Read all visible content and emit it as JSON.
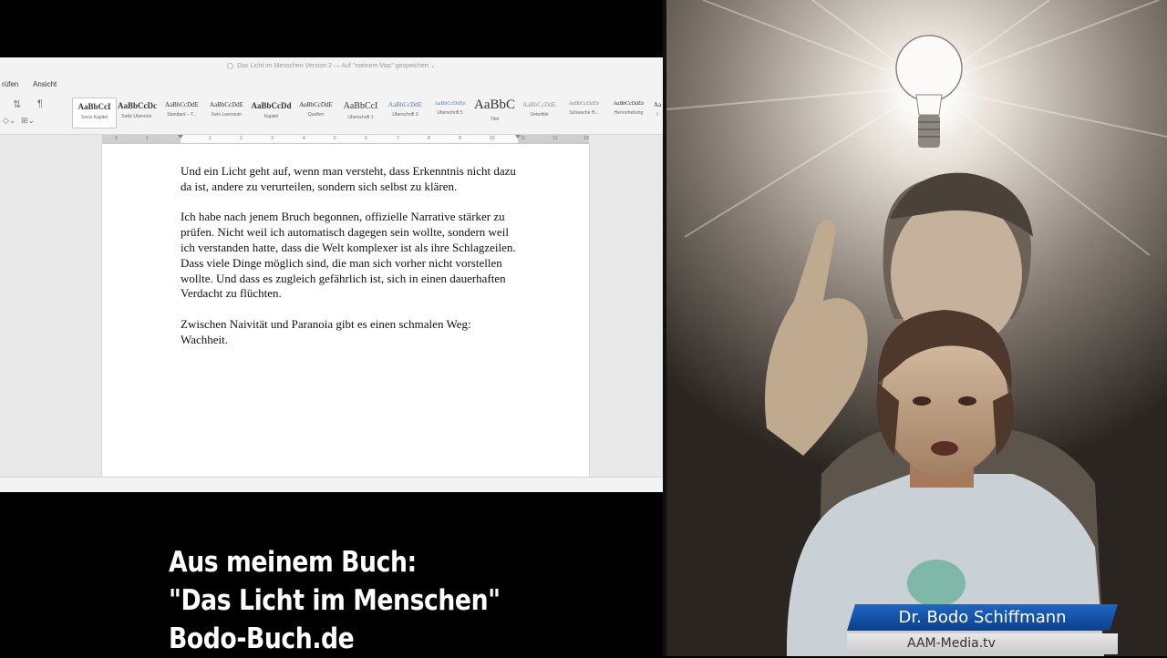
{
  "word": {
    "window_title": "Das Licht im Menschen Version 2 — Auf \"meinem Mac\" gespeichert ⌄",
    "menu": [
      "rüfen",
      "Ansicht"
    ],
    "styles": [
      {
        "sample": "AaBbCcI",
        "name": "Socio Kapitel"
      },
      {
        "sample": "AaBbCcDc",
        "name": "Sodo Überschr."
      },
      {
        "sample": "AaBbCcDdE",
        "name": "Standard – T..."
      },
      {
        "sample": "AaBbCcDdE",
        "name": "Kein Leerraum"
      },
      {
        "sample": "AaBbCcDd",
        "name": "Kapitel"
      },
      {
        "sample": "AaBbCcDdE",
        "name": "Quellen"
      },
      {
        "sample": "AaBbCcI",
        "name": "Überschrift 1"
      },
      {
        "sample": "AaBbCcDdE",
        "name": "Überschrift 3"
      },
      {
        "sample": "AaBbCcDdEe",
        "name": "Überschrift 5"
      },
      {
        "sample": "AaBbC",
        "name": "Titel"
      },
      {
        "sample": "AaBbCcDdE",
        "name": "Untertitle"
      },
      {
        "sample": "AaBbCcDdEe",
        "name": "Schwache H..."
      },
      {
        "sample": "AaBbCcDdEe",
        "name": "Hervorhebung"
      },
      {
        "sample": "Aa",
        "name": "I"
      }
    ],
    "ruler_numbers": [
      "2",
      "1",
      "",
      "1",
      "2",
      "3",
      "4",
      "5",
      "6",
      "7",
      "8",
      "9",
      "10",
      "11",
      "12",
      "13"
    ],
    "paragraphs": [
      "Und ein Licht geht auf, wenn man versteht, dass Erkenntnis nicht dazu da ist, andere zu verurteilen, sondern sich selbst zu klären.",
      "Ich habe nach jenem Bruch begonnen, offizielle Narrative stärker zu prüfen. Nicht weil ich automatisch dagegen sein wollte, sondern weil ich verstanden hatte, dass die Welt komplexer ist als ihre Schlagzeilen. Dass viele Dinge möglich sind, die man sich vorher nicht vorstellen wollte. Und dass es zugleich gefährlich ist, sich in einen dauerhaften Verdacht zu flüchten.",
      "Zwischen Naivität und Paranoia gibt es einen schmalen Weg: Wachheit."
    ]
  },
  "caption": {
    "line1": "Aus meinem Buch:",
    "line2": "\"Das Licht im Menschen\"",
    "line3": "Bodo-Buch.de"
  },
  "lower_third": {
    "name": "Dr. Bodo Schiffmann",
    "site": "AAM-Media.tv"
  },
  "colors": {
    "name_bar": "#1553ad",
    "site_bar": "#d8d8d8"
  }
}
